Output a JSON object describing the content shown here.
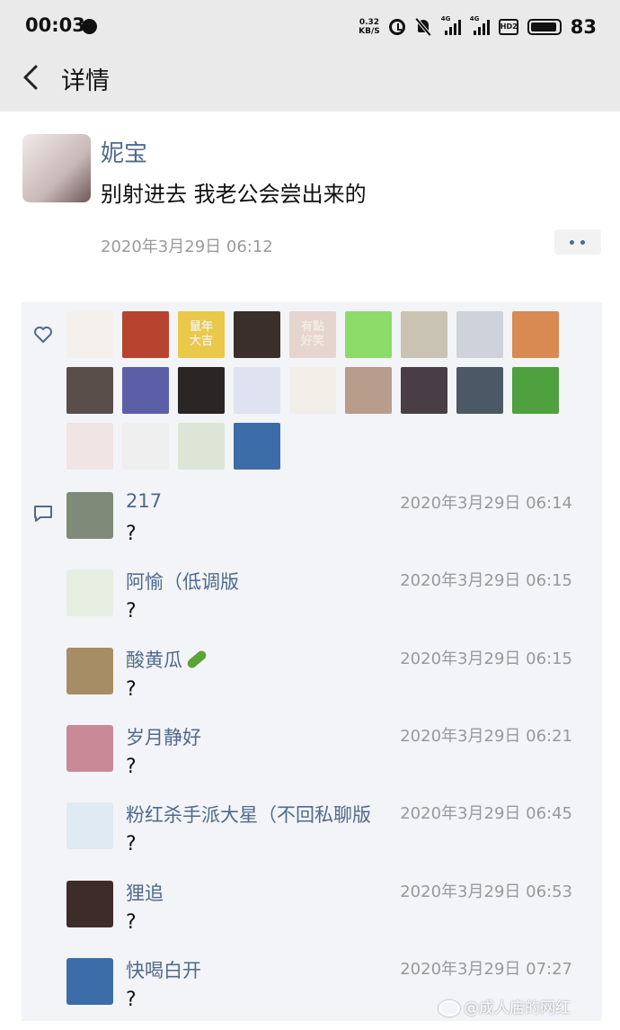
{
  "status_bar": {
    "time": "00:03",
    "net_speed_value": "0.32",
    "net_speed_unit": "KB/S",
    "signal_1_label": "4G",
    "signal_2_label": "4G",
    "hd_label": "HD2",
    "battery": "83",
    "icons": [
      "notification-dot-icon",
      "alarm-icon",
      "mute-icon",
      "signal-icon",
      "signal-icon",
      "hd-icon",
      "battery-icon"
    ]
  },
  "header": {
    "title": "详情",
    "back_icon": "chevron-left-icon"
  },
  "post": {
    "author": "妮宝",
    "text": "别射进去 我老公会尝出来的",
    "time": "2020年3月29日 06:12",
    "more_icon": "more-dots-icon"
  },
  "likes": {
    "icon": "heart-outline-icon",
    "avatar_colors": [
      "#f4f1ec",
      "#b8432e",
      "#e9c84a",
      "#3a2f2a",
      "#e6d4cf",
      "#8ddc6a",
      "#c9c3b4",
      "#cfd2da",
      "#d88a52",
      "#5a4e4a",
      "#5b5fa8",
      "#2a2626",
      "#dfe2f0",
      "#f1efe8",
      "#b89c8c",
      "#4a3e46",
      "#4b5866",
      "#4fa03e",
      "#f1e4e4",
      "#efefef",
      "#dde6d6",
      "#3d6da8"
    ],
    "avatar_labels": {
      "2": "鼠年\n大吉",
      "4": "有點\n好笑"
    }
  },
  "comments": {
    "icon": "comment-icon",
    "items": [
      {
        "name": "217",
        "time": "2020年3月29日 06:14",
        "text": "?",
        "avatar_color": "#7f8a78"
      },
      {
        "name": "阿愉（低调版",
        "time": "2020年3月29日 06:15",
        "text": "?",
        "avatar_color": "#e7eee2"
      },
      {
        "name": "酸黄瓜",
        "time": "2020年3月29日 06:15",
        "text": "?",
        "avatar_color": "#a78d66",
        "emoji_icon": "cucumber-icon"
      },
      {
        "name": "岁月静好",
        "time": "2020年3月29日 06:21",
        "text": "?",
        "avatar_color": "#c98996"
      },
      {
        "name": "粉红杀手派大星（不回私聊版",
        "time": "2020年3月29日 06:45",
        "text": "?",
        "avatar_color": "#dfeaf2"
      },
      {
        "name": "狸追",
        "time": "2020年3月29日 06:53",
        "text": "?",
        "avatar_color": "#3e2c2a"
      },
      {
        "name": "快喝白开",
        "time": "2020年3月29日 07:27",
        "text": "?",
        "avatar_color": "#3d6da8"
      }
    ]
  },
  "watermark": {
    "text": "@成人店的网红",
    "icon": "weibo-icon"
  }
}
